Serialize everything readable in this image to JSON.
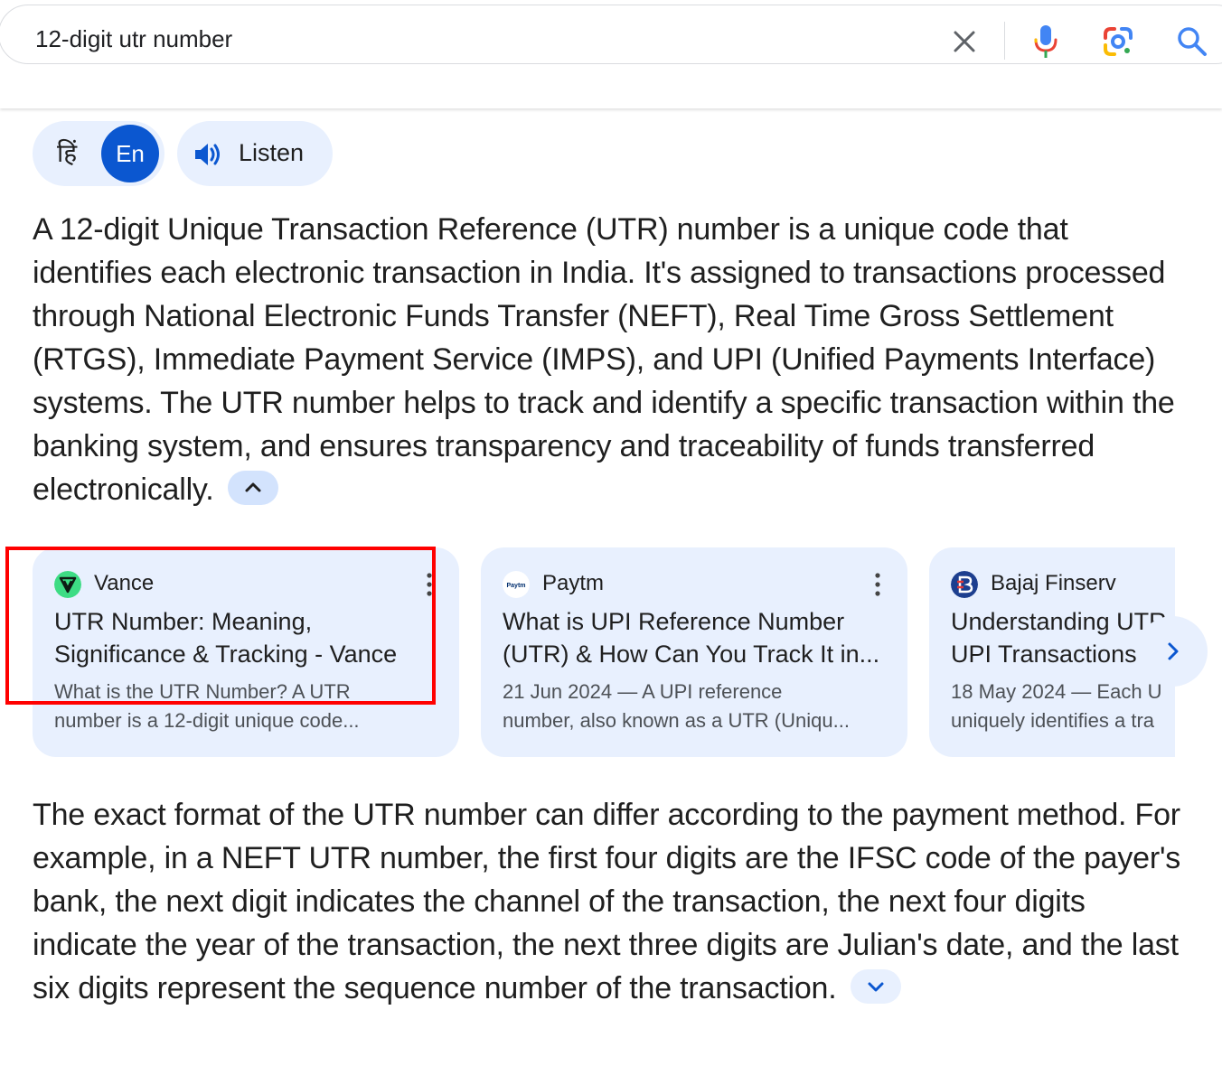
{
  "search": {
    "query": "12-digit utr number"
  },
  "language": {
    "hindi_label": "हिं",
    "english_label": "En"
  },
  "listen": {
    "label": "Listen"
  },
  "overview": {
    "paragraph1": "A 12-digit Unique Transaction Reference (UTR) number is a unique code that identifies each electronic transaction in India. It's assigned to transactions processed through National Electronic Funds Transfer (NEFT), Real Time Gross Settlement (RTGS), Immediate Payment Service (IMPS), and UPI (Unified Payments Interface) systems. The UTR number helps to track and identify a specific transaction within the banking system, and ensures transparency and traceability of funds transferred electronically.",
    "paragraph2": "The exact format of the UTR number can differ according to the payment method. For example, in a NEFT UTR number, the first four digits are the IFSC code of the payer's bank, the next digit indicates the channel of the transaction, the next four digits indicate the year of the transaction, the next three digits are Julian's date, and the last six digits represent the sequence number of the transaction."
  },
  "sources": [
    {
      "site": "Vance",
      "favicon_color": "#3ddc84",
      "title_line1": "UTR Number: Meaning,",
      "title_line2": "Significance & Tracking - Vance",
      "snippet_line1": "What is the UTR Number? A UTR",
      "snippet_line2": "number is a 12-digit unique code..."
    },
    {
      "site": "Paytm",
      "favicon_text": "Paytm",
      "title_line1": "What is UPI Reference Number",
      "title_line2": "(UTR) & How Can You Track It in...",
      "snippet_line1": "21 Jun 2024 — A UPI reference",
      "snippet_line2": "number, also known as a UTR (Uniqu..."
    },
    {
      "site": "Bajaj Finserv",
      "favicon_color": "#1d3f8f",
      "title_line1": "Understanding UTR",
      "title_line2": "UPI Transactions",
      "snippet_line1": "18 May 2024 — Each U",
      "snippet_line2": "uniquely identifies a tra"
    }
  ],
  "colors": {
    "accent": "#0b57d0",
    "card_bg": "#e8f0fe",
    "highlight": "#ff0000"
  }
}
